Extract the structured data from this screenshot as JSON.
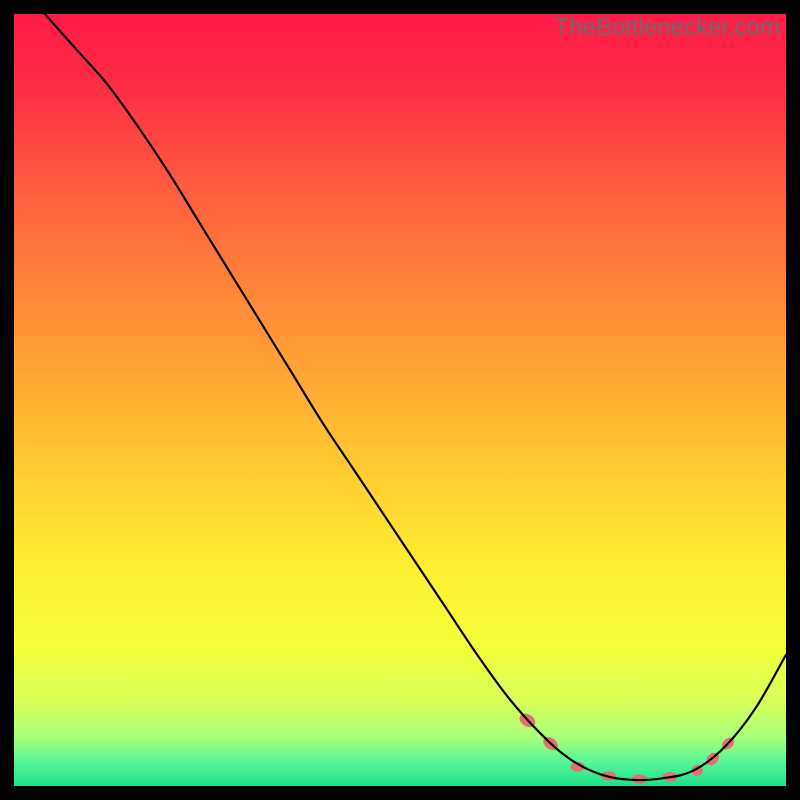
{
  "watermark": "TheBottlenecker.com",
  "chart_data": {
    "type": "line",
    "title": "",
    "xlabel": "",
    "ylabel": "",
    "xlim": [
      0,
      100
    ],
    "ylim": [
      0,
      100
    ],
    "grid": false,
    "background_gradient": {
      "stops": [
        {
          "offset": 0.0,
          "color": "#ff1a47"
        },
        {
          "offset": 0.1,
          "color": "#ff2f44"
        },
        {
          "offset": 0.22,
          "color": "#ff5a3f"
        },
        {
          "offset": 0.35,
          "color": "#ff8339"
        },
        {
          "offset": 0.48,
          "color": "#ffaa33"
        },
        {
          "offset": 0.6,
          "color": "#ffce2f"
        },
        {
          "offset": 0.72,
          "color": "#ffef33"
        },
        {
          "offset": 0.82,
          "color": "#f3ff3a"
        },
        {
          "offset": 0.885,
          "color": "#dcff55"
        },
        {
          "offset": 0.935,
          "color": "#aaff77"
        },
        {
          "offset": 0.97,
          "color": "#55f596"
        },
        {
          "offset": 1.0,
          "color": "#1fe089"
        }
      ]
    },
    "series": [
      {
        "name": "curve",
        "stroke": "#000000",
        "stroke_width": 2.2,
        "points": [
          {
            "x": 4.0,
            "y": 100.0
          },
          {
            "x": 8.0,
            "y": 95.5
          },
          {
            "x": 12.0,
            "y": 91.0
          },
          {
            "x": 16.0,
            "y": 85.5
          },
          {
            "x": 20.0,
            "y": 79.5
          },
          {
            "x": 24.0,
            "y": 73.0
          },
          {
            "x": 28.0,
            "y": 66.5
          },
          {
            "x": 32.0,
            "y": 60.0
          },
          {
            "x": 36.0,
            "y": 53.5
          },
          {
            "x": 40.0,
            "y": 47.0
          },
          {
            "x": 44.0,
            "y": 41.0
          },
          {
            "x": 48.0,
            "y": 35.0
          },
          {
            "x": 52.0,
            "y": 29.0
          },
          {
            "x": 56.0,
            "y": 23.0
          },
          {
            "x": 60.0,
            "y": 17.0
          },
          {
            "x": 64.0,
            "y": 11.5
          },
          {
            "x": 68.0,
            "y": 7.0
          },
          {
            "x": 72.0,
            "y": 3.5
          },
          {
            "x": 76.0,
            "y": 1.5
          },
          {
            "x": 80.0,
            "y": 0.8
          },
          {
            "x": 84.0,
            "y": 1.0
          },
          {
            "x": 88.0,
            "y": 2.0
          },
          {
            "x": 92.0,
            "y": 5.0
          },
          {
            "x": 96.0,
            "y": 10.0
          },
          {
            "x": 100.0,
            "y": 17.0
          }
        ]
      }
    ],
    "markers": {
      "stroke": "#e17070",
      "fill": "#e17070",
      "points": [
        {
          "x": 66.5,
          "y": 8.5,
          "rx": 5.5,
          "ry": 8.0,
          "rot": -58
        },
        {
          "x": 69.5,
          "y": 5.5,
          "rx": 5.0,
          "ry": 7.5,
          "rot": -55
        },
        {
          "x": 73.0,
          "y": 2.5,
          "rx": 6.5,
          "ry": 4.5,
          "rot": 0
        },
        {
          "x": 77.0,
          "y": 1.3,
          "rx": 7.0,
          "ry": 4.2,
          "rot": 0
        },
        {
          "x": 81.0,
          "y": 0.9,
          "rx": 7.0,
          "ry": 4.2,
          "rot": 0
        },
        {
          "x": 85.0,
          "y": 1.2,
          "rx": 7.0,
          "ry": 4.2,
          "rot": 0
        },
        {
          "x": 88.5,
          "y": 2.0,
          "rx": 5.0,
          "ry": 5.0,
          "rot": 0
        },
        {
          "x": 90.5,
          "y": 3.5,
          "rx": 4.8,
          "ry": 6.5,
          "rot": 45
        },
        {
          "x": 92.5,
          "y": 5.5,
          "rx": 4.5,
          "ry": 6.2,
          "rot": 50
        }
      ]
    }
  }
}
